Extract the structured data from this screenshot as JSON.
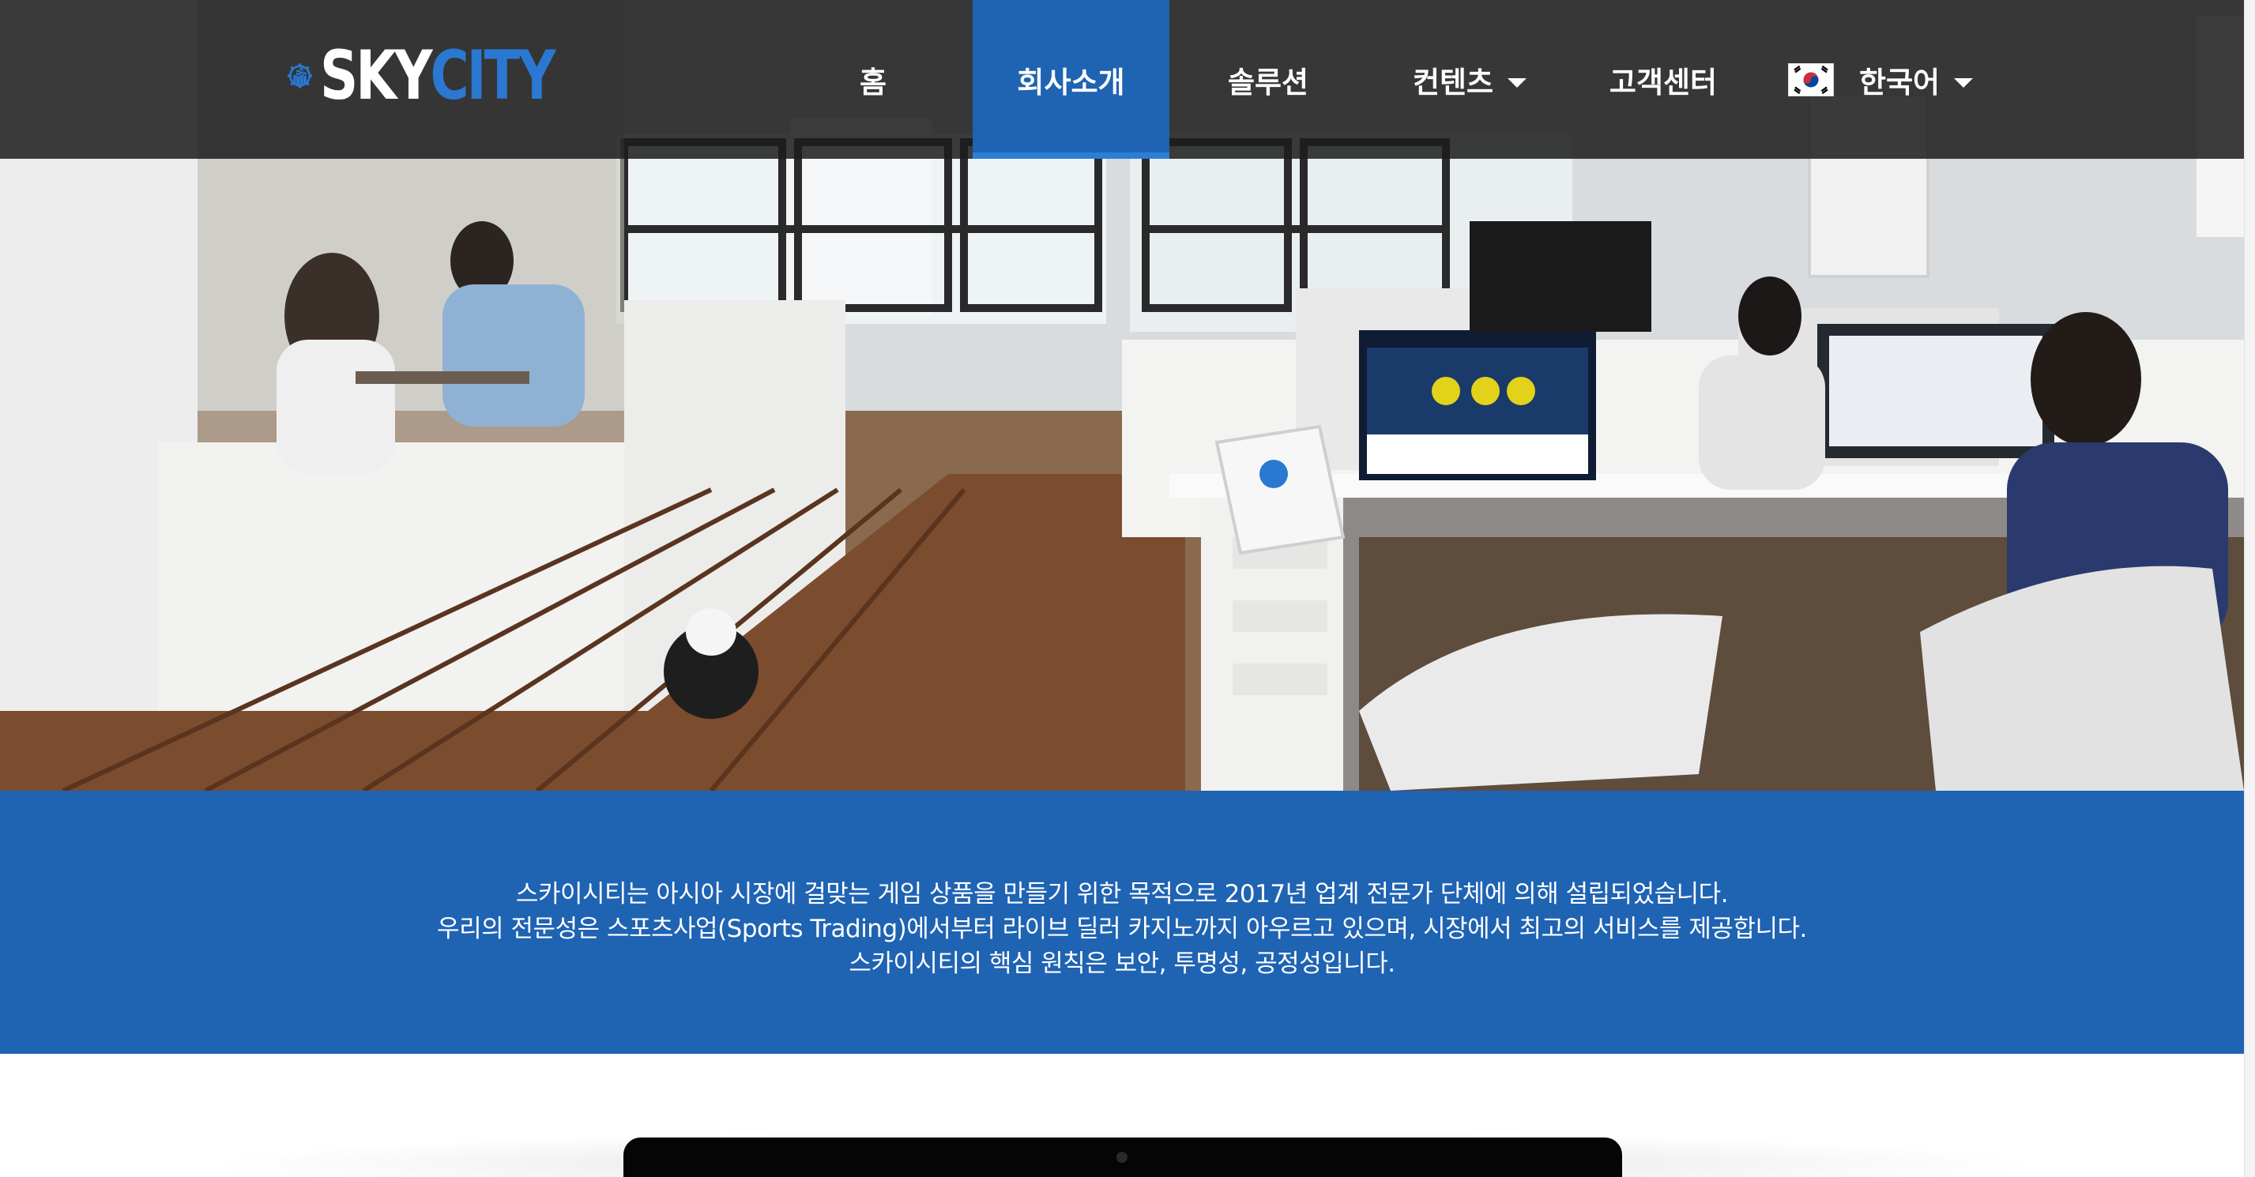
{
  "brand": {
    "sky": "SKY",
    "city": "CITY"
  },
  "nav": {
    "items": [
      {
        "label": "홈",
        "active": false,
        "dropdown": false
      },
      {
        "label": "회사소개",
        "active": true,
        "dropdown": false
      },
      {
        "label": "솔루션",
        "active": false,
        "dropdown": false
      },
      {
        "label": "컨텐츠",
        "active": false,
        "dropdown": true
      },
      {
        "label": "고객센터",
        "active": false,
        "dropdown": false
      }
    ],
    "language": {
      "label": "한국어",
      "flag_icon": "korea-flag-icon",
      "dropdown": true
    }
  },
  "intro": {
    "lines": [
      "스카이시티는 아시아 시장에 걸맞는 게임 상품을 만들기 위한 목적으로 2017년 업계 전문가 단체에 의해 설립되었습니다.",
      "우리의 전문성은 스포츠사업(Sports Trading)에서부터 라이브 딜러 카지노까지 아우르고 있으며, 시장에서 최고의 서비스를 제공합니다.",
      "스카이시티의 핵심 원칙은 보안, 투명성, 공정성입니다."
    ]
  },
  "colors": {
    "nav_bg": "#1c1c1c",
    "accent_blue": "#1f63b3",
    "logo_blue": "#2a78d2",
    "text_white": "#ffffff"
  }
}
